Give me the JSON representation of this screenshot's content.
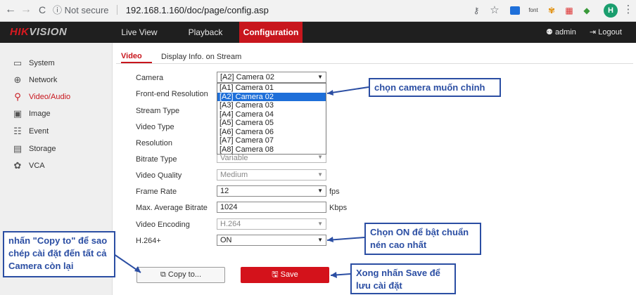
{
  "browser": {
    "back_icon": "←",
    "forward_icon": "→",
    "reload_icon": "C",
    "info_icon": "ⓘ",
    "security_label": "Not secure",
    "url": "192.168.1.160/doc/page/config.asp",
    "key_icon": "⚷",
    "star_icon": "☆",
    "profile_initial": "H",
    "ext_font_label": "font",
    "menu_icon": "⋮"
  },
  "app": {
    "logo_hik": "HIK",
    "logo_vision": "VISION",
    "nav": [
      "Live View",
      "Playback",
      "Configuration"
    ],
    "user_icon": "⚉",
    "user": "admin",
    "logout_icon": "⇥",
    "logout": "Logout"
  },
  "sidebar": {
    "items": [
      {
        "label": "System",
        "icon": "▭"
      },
      {
        "label": "Network",
        "icon": "⊕"
      },
      {
        "label": "Video/Audio",
        "icon": "⚲"
      },
      {
        "label": "Image",
        "icon": "▣"
      },
      {
        "label": "Event",
        "icon": "☷"
      },
      {
        "label": "Storage",
        "icon": "▤"
      },
      {
        "label": "VCA",
        "icon": "✿"
      }
    ]
  },
  "tabs": [
    "Video",
    "Display Info. on Stream"
  ],
  "form": {
    "camera_label": "Camera",
    "camera_value": "[A2] Camera 02",
    "front_end_label": "Front-end Resolution",
    "stream_type_label": "Stream Type",
    "video_type_label": "Video Type",
    "resolution_label": "Resolution",
    "bitrate_type_label": "Bitrate Type",
    "bitrate_type_value": "Variable",
    "video_quality_label": "Video Quality",
    "video_quality_value": "Medium",
    "frame_rate_label": "Frame Rate",
    "frame_rate_value": "12",
    "frame_rate_unit": "fps",
    "max_bitrate_label": "Max. Average Bitrate",
    "max_bitrate_value": "1024",
    "max_bitrate_unit": "Kbps",
    "video_encoding_label": "Video Encoding",
    "video_encoding_value": "H.264",
    "h264plus_label": "H.264+",
    "h264plus_value": "ON",
    "arrow": "▼"
  },
  "camera_options": [
    "[A1] Camera 01",
    "[A2] Camera 02",
    "[A3] Camera 03",
    "[A4] Camera 04",
    "[A5] Camera 05",
    "[A6] Camera 06",
    "[A7] Camera 07",
    "[A8] Camera 08"
  ],
  "buttons": {
    "copy_icon": "⧉",
    "copy": "Copy to...",
    "save_icon": "🖫",
    "save": "Save"
  },
  "annotations": {
    "camera_note": "chọn camera muốn chỉnh",
    "h264_note_line1": "Chọn ON để bật chuẩn",
    "h264_note_line2": "nén cao nhất",
    "copy_note_line1": "nhấn \"Copy to\" để sao",
    "copy_note_line2": "chép cài đặt đến tất cả",
    "copy_note_line3": "Camera còn lại",
    "save_note_line1": "Xong nhấn Save để",
    "save_note_line2": "lưu cài đặt",
    "color": "#2b4ea3"
  },
  "colors": {
    "accent_red": "#c8161d",
    "selection_blue": "#1e6fd9"
  }
}
